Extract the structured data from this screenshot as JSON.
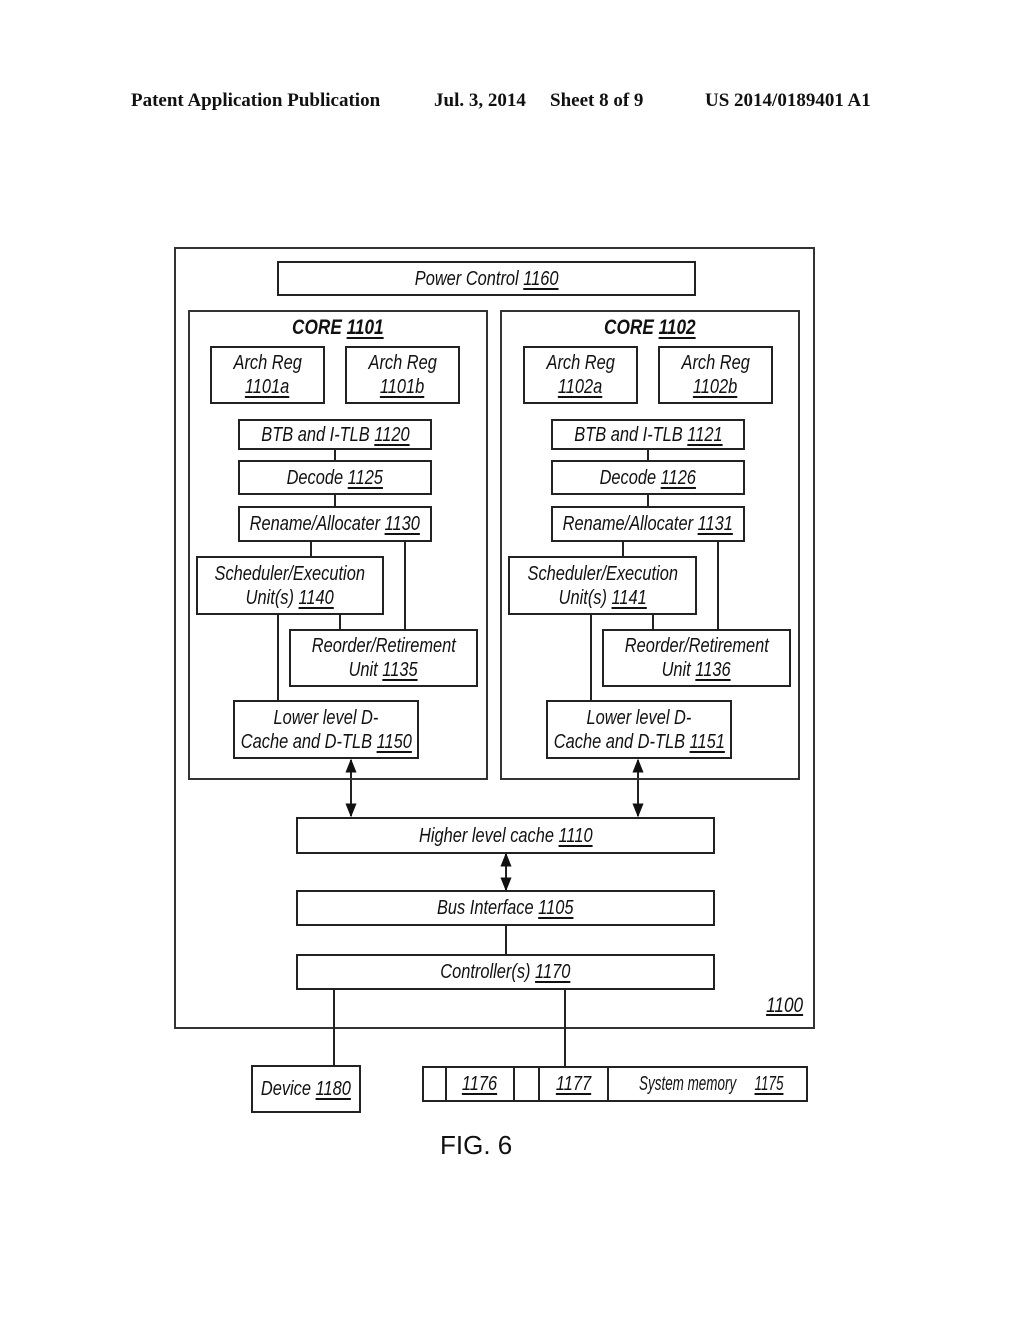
{
  "header": {
    "publication": "Patent Application Publication",
    "date": "Jul. 3, 2014",
    "sheet": "Sheet 8 of 9",
    "number": "US 2014/0189401 A1"
  },
  "diagram": {
    "outer_ref": "1100",
    "power_control": {
      "label": "Power Control",
      "ref": "1160"
    },
    "cores": [
      {
        "title": "CORE",
        "ref": "1101",
        "arch_regs": [
          {
            "label": "Arch Reg",
            "ref": "1101a"
          },
          {
            "label": "Arch Reg",
            "ref": "1101b"
          }
        ],
        "btb": {
          "label": "BTB and I-TLB",
          "ref": "1120"
        },
        "decode": {
          "label": "Decode",
          "ref": "1125"
        },
        "rename": {
          "label": "Rename/Allocater",
          "ref": "1130"
        },
        "scheduler": {
          "label1": "Scheduler/Execution",
          "label2": "Unit(s)",
          "ref": "1140"
        },
        "reorder": {
          "label1": "Reorder/Retirement",
          "label2": "Unit",
          "ref": "1135"
        },
        "dcache": {
          "label1": "Lower level D-",
          "label2": "Cache and D-TLB",
          "ref": "1150"
        }
      },
      {
        "title": "CORE",
        "ref": "1102",
        "arch_regs": [
          {
            "label": "Arch Reg",
            "ref": "1102a"
          },
          {
            "label": "Arch Reg",
            "ref": "1102b"
          }
        ],
        "btb": {
          "label": "BTB and I-TLB",
          "ref": "1121"
        },
        "decode": {
          "label": "Decode",
          "ref": "1126"
        },
        "rename": {
          "label": "Rename/Allocater",
          "ref": "1131"
        },
        "scheduler": {
          "label1": "Scheduler/Execution",
          "label2": "Unit(s)",
          "ref": "1141"
        },
        "reorder": {
          "label1": "Reorder/Retirement",
          "label2": "Unit",
          "ref": "1136"
        },
        "dcache": {
          "label1": "Lower level D-",
          "label2": "Cache and D-TLB",
          "ref": "1151"
        }
      }
    ],
    "higher_cache": {
      "label": "Higher level cache",
      "ref": "1110"
    },
    "bus_interface": {
      "label": "Bus Interface",
      "ref": "1105"
    },
    "controllers": {
      "label": "Controller(s)",
      "ref": "1170"
    },
    "device": {
      "label": "Device",
      "ref": "1180"
    },
    "memory": {
      "cells": [
        "",
        "1176",
        "",
        "1177"
      ],
      "label": "System memory",
      "ref": "1175"
    }
  },
  "figure_label": "FIG. 6"
}
